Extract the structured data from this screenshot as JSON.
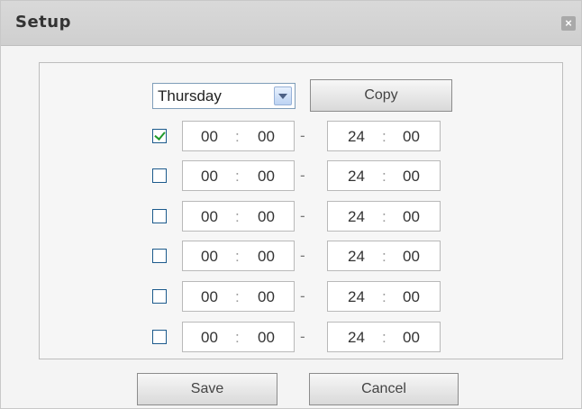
{
  "dialog": {
    "title": "Setup",
    "close_glyph": "×"
  },
  "day_select": {
    "value": "Thursday"
  },
  "buttons": {
    "copy": "Copy",
    "save": "Save",
    "cancel": "Cancel"
  },
  "periods": [
    {
      "enabled": true,
      "start_hour": "00",
      "start_minute": "00",
      "end_hour": "24",
      "end_minute": "00"
    },
    {
      "enabled": false,
      "start_hour": "00",
      "start_minute": "00",
      "end_hour": "24",
      "end_minute": "00"
    },
    {
      "enabled": false,
      "start_hour": "00",
      "start_minute": "00",
      "end_hour": "24",
      "end_minute": "00"
    },
    {
      "enabled": false,
      "start_hour": "00",
      "start_minute": "00",
      "end_hour": "24",
      "end_minute": "00"
    },
    {
      "enabled": false,
      "start_hour": "00",
      "start_minute": "00",
      "end_hour": "24",
      "end_minute": "00"
    },
    {
      "enabled": false,
      "start_hour": "00",
      "start_minute": "00",
      "end_hour": "24",
      "end_minute": "00"
    }
  ],
  "separators": {
    "time": ":",
    "range": "-"
  },
  "colors": {
    "check_mark": "#1f9a2b",
    "titlebar": "#d4d4d4"
  }
}
